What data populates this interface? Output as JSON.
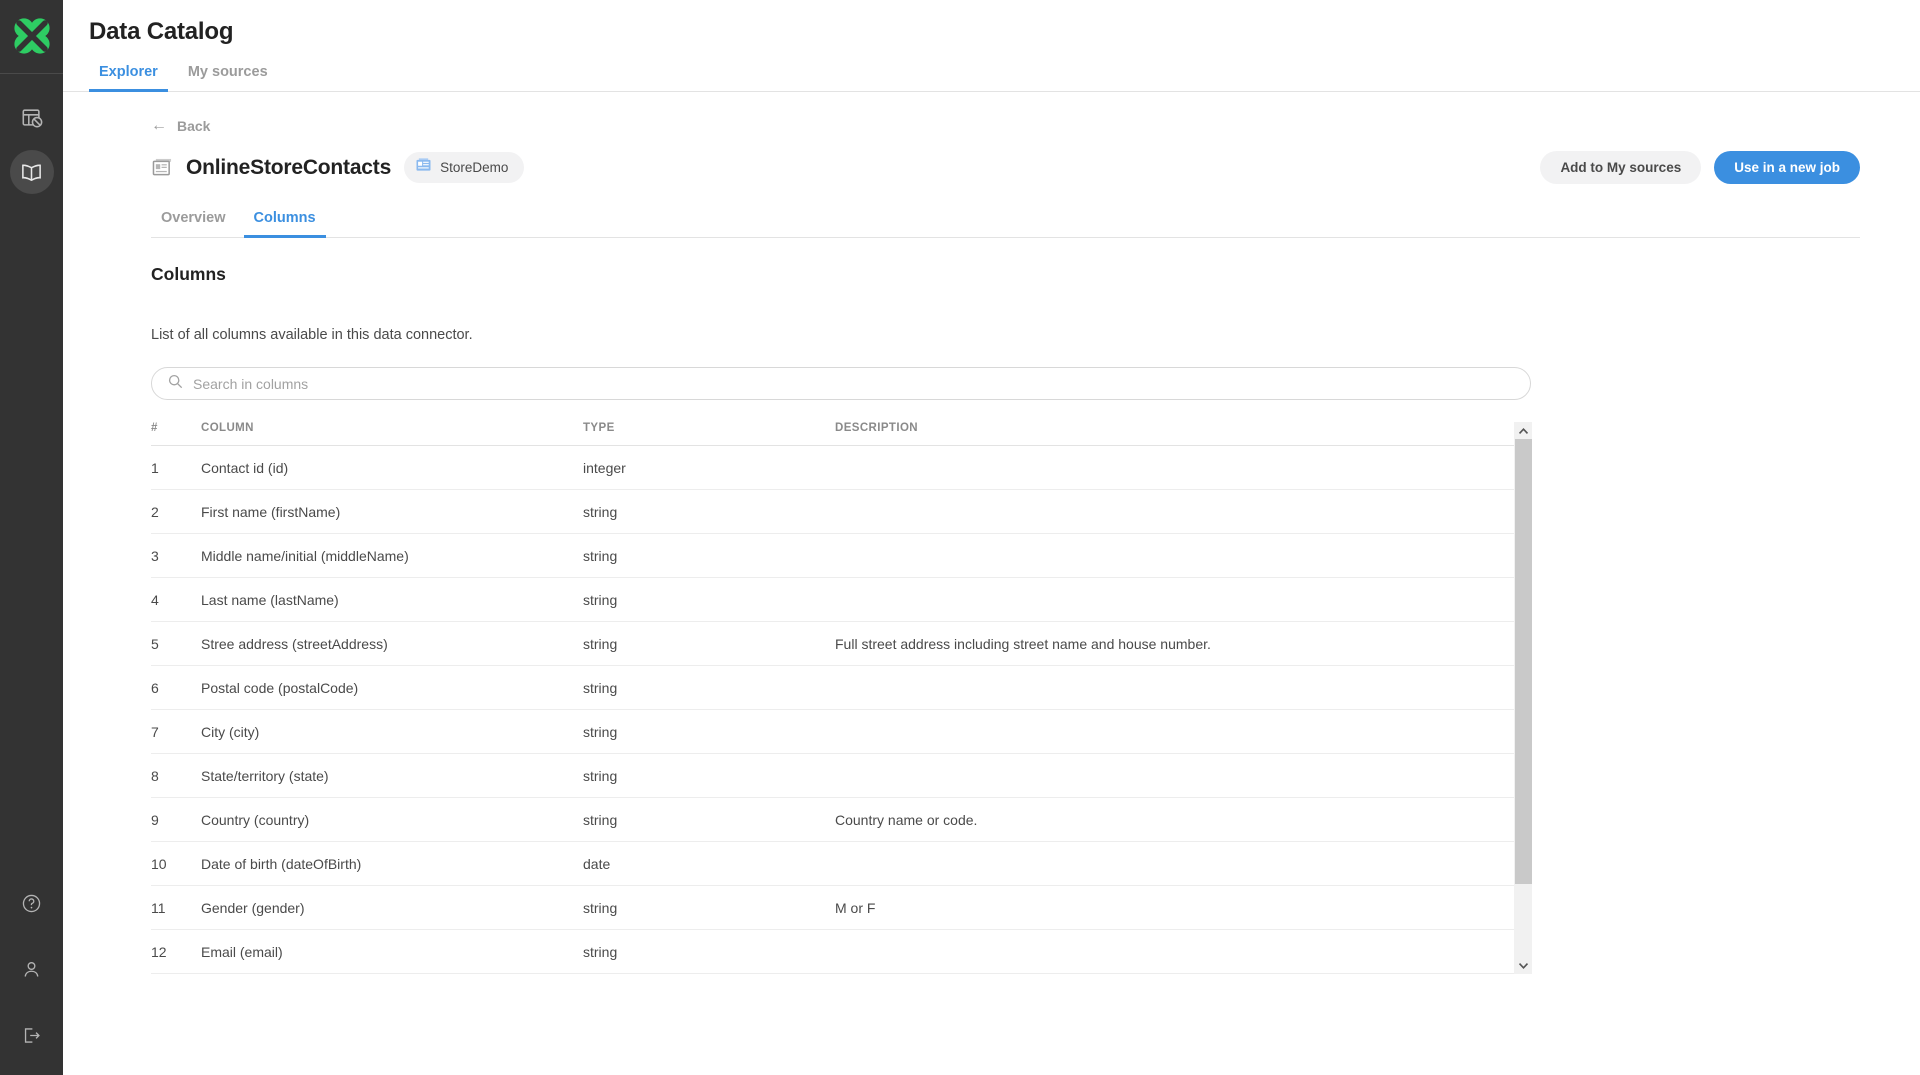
{
  "rail": {
    "logo_icon": "clover-logo",
    "logo_color": "#2ecc63",
    "items": [
      {
        "icon": "table-disabled-icon",
        "name": "jobs",
        "active": false
      },
      {
        "icon": "book-icon",
        "name": "data-catalog",
        "active": true
      }
    ],
    "bottom_items": [
      {
        "icon": "help-circle-icon",
        "name": "help"
      },
      {
        "icon": "user-icon",
        "name": "account"
      },
      {
        "icon": "logout-icon",
        "name": "logout"
      }
    ]
  },
  "header": {
    "title": "Data Catalog",
    "tabs": [
      {
        "label": "Explorer",
        "active": true
      },
      {
        "label": "My sources",
        "active": false
      }
    ]
  },
  "breadcrumb": {
    "back_label": "Back",
    "back_icon": "arrow-left-icon"
  },
  "entity": {
    "icon": "contact-card-icon",
    "name": "OnlineStoreContacts",
    "source_badge": {
      "icon": "data-source-icon",
      "label": "StoreDemo"
    }
  },
  "actions": {
    "add_to_my_sources": "Add to My sources",
    "use_in_new_job": "Use in a new job",
    "primary_color": "#3b8fe0"
  },
  "subtabs": [
    {
      "label": "Overview",
      "active": false
    },
    {
      "label": "Columns",
      "active": true
    }
  ],
  "section": {
    "title": "Columns",
    "description": "List of all columns available in this data connector."
  },
  "search": {
    "icon": "search-icon",
    "placeholder": "Search in columns",
    "value": ""
  },
  "table": {
    "headers": [
      "#",
      "COLUMN",
      "TYPE",
      "DESCRIPTION"
    ],
    "rows": [
      {
        "num": "1",
        "column": "Contact id (id)",
        "type": "integer",
        "description": ""
      },
      {
        "num": "2",
        "column": "First name (firstName)",
        "type": "string",
        "description": ""
      },
      {
        "num": "3",
        "column": "Middle name/initial (middleName)",
        "type": "string",
        "description": ""
      },
      {
        "num": "4",
        "column": "Last name (lastName)",
        "type": "string",
        "description": ""
      },
      {
        "num": "5",
        "column": "Stree address (streetAddress)",
        "type": "string",
        "description": "Full street address including street name and house number."
      },
      {
        "num": "6",
        "column": "Postal code (postalCode)",
        "type": "string",
        "description": ""
      },
      {
        "num": "7",
        "column": "City (city)",
        "type": "string",
        "description": ""
      },
      {
        "num": "8",
        "column": "State/territory (state)",
        "type": "string",
        "description": ""
      },
      {
        "num": "9",
        "column": "Country (country)",
        "type": "string",
        "description": "Country name or code."
      },
      {
        "num": "10",
        "column": "Date of birth (dateOfBirth)",
        "type": "date",
        "description": ""
      },
      {
        "num": "11",
        "column": "Gender (gender)",
        "type": "string",
        "description": "M or F"
      },
      {
        "num": "12",
        "column": "Email (email)",
        "type": "string",
        "description": ""
      }
    ]
  },
  "scrollbar": {
    "up_icon": "chevron-up-icon",
    "down_icon": "chevron-down-icon",
    "thumb_ratio": "86%"
  }
}
